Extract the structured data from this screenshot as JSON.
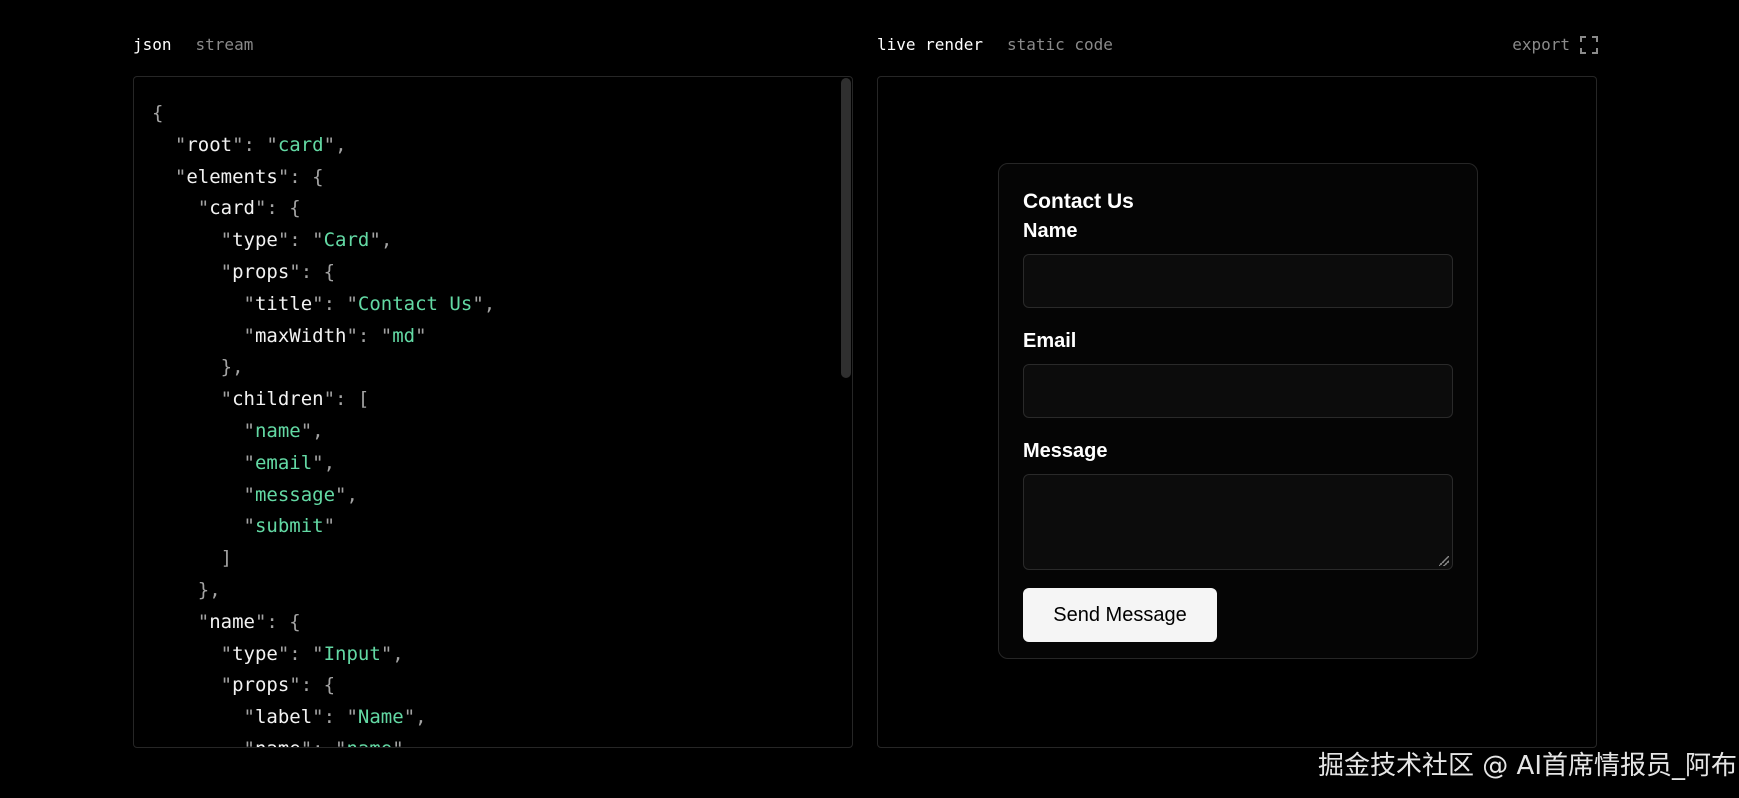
{
  "left_tabs": [
    "json",
    "stream"
  ],
  "right_tabs": [
    "live render",
    "static code"
  ],
  "export_label": "export",
  "code_lines": [
    [
      [
        "p",
        "{"
      ]
    ],
    [
      [
        "p",
        "  \""
      ],
      [
        "k",
        "root"
      ],
      [
        "p",
        "\": \""
      ],
      [
        "s",
        "card"
      ],
      [
        "p",
        "\","
      ]
    ],
    [
      [
        "p",
        "  \""
      ],
      [
        "k",
        "elements"
      ],
      [
        "p",
        "\": {"
      ]
    ],
    [
      [
        "p",
        "    \""
      ],
      [
        "k",
        "card"
      ],
      [
        "p",
        "\": {"
      ]
    ],
    [
      [
        "p",
        "      \""
      ],
      [
        "k",
        "type"
      ],
      [
        "p",
        "\": \""
      ],
      [
        "s",
        "Card"
      ],
      [
        "p",
        "\","
      ]
    ],
    [
      [
        "p",
        "      \""
      ],
      [
        "k",
        "props"
      ],
      [
        "p",
        "\": {"
      ]
    ],
    [
      [
        "p",
        "        \""
      ],
      [
        "k",
        "title"
      ],
      [
        "p",
        "\": \""
      ],
      [
        "s",
        "Contact Us"
      ],
      [
        "p",
        "\","
      ]
    ],
    [
      [
        "p",
        "        \""
      ],
      [
        "k",
        "maxWidth"
      ],
      [
        "p",
        "\": \""
      ],
      [
        "s",
        "md"
      ],
      [
        "p",
        "\""
      ]
    ],
    [
      [
        "p",
        "      },"
      ]
    ],
    [
      [
        "p",
        "      \""
      ],
      [
        "k",
        "children"
      ],
      [
        "p",
        "\": ["
      ]
    ],
    [
      [
        "p",
        "        \""
      ],
      [
        "s",
        "name"
      ],
      [
        "p",
        "\","
      ]
    ],
    [
      [
        "p",
        "        \""
      ],
      [
        "s",
        "email"
      ],
      [
        "p",
        "\","
      ]
    ],
    [
      [
        "p",
        "        \""
      ],
      [
        "s",
        "message"
      ],
      [
        "p",
        "\","
      ]
    ],
    [
      [
        "p",
        "        \""
      ],
      [
        "s",
        "submit"
      ],
      [
        "p",
        "\""
      ]
    ],
    [
      [
        "p",
        "      ]"
      ]
    ],
    [
      [
        "p",
        "    },"
      ]
    ],
    [
      [
        "p",
        "    \""
      ],
      [
        "k",
        "name"
      ],
      [
        "p",
        "\": {"
      ]
    ],
    [
      [
        "p",
        "      \""
      ],
      [
        "k",
        "type"
      ],
      [
        "p",
        "\": \""
      ],
      [
        "s",
        "Input"
      ],
      [
        "p",
        "\","
      ]
    ],
    [
      [
        "p",
        "      \""
      ],
      [
        "k",
        "props"
      ],
      [
        "p",
        "\": {"
      ]
    ],
    [
      [
        "p",
        "        \""
      ],
      [
        "k",
        "label"
      ],
      [
        "p",
        "\": \""
      ],
      [
        "s",
        "Name"
      ],
      [
        "p",
        "\","
      ]
    ],
    [
      [
        "p",
        "        \""
      ],
      [
        "k",
        "name"
      ],
      [
        "p",
        "\": \""
      ],
      [
        "s",
        "name"
      ],
      [
        "p",
        "\""
      ]
    ]
  ],
  "card": {
    "title": "Contact Us",
    "fields": {
      "name_label": "Name",
      "email_label": "Email",
      "message_label": "Message"
    },
    "submit_label": "Send Message"
  },
  "watermark": "掘金技术社区 @ AI首席情报员_阿布",
  "colors": {
    "string": "#63d9a4",
    "key": "#f2f2f2",
    "punctuation": "#a3a3a3"
  }
}
